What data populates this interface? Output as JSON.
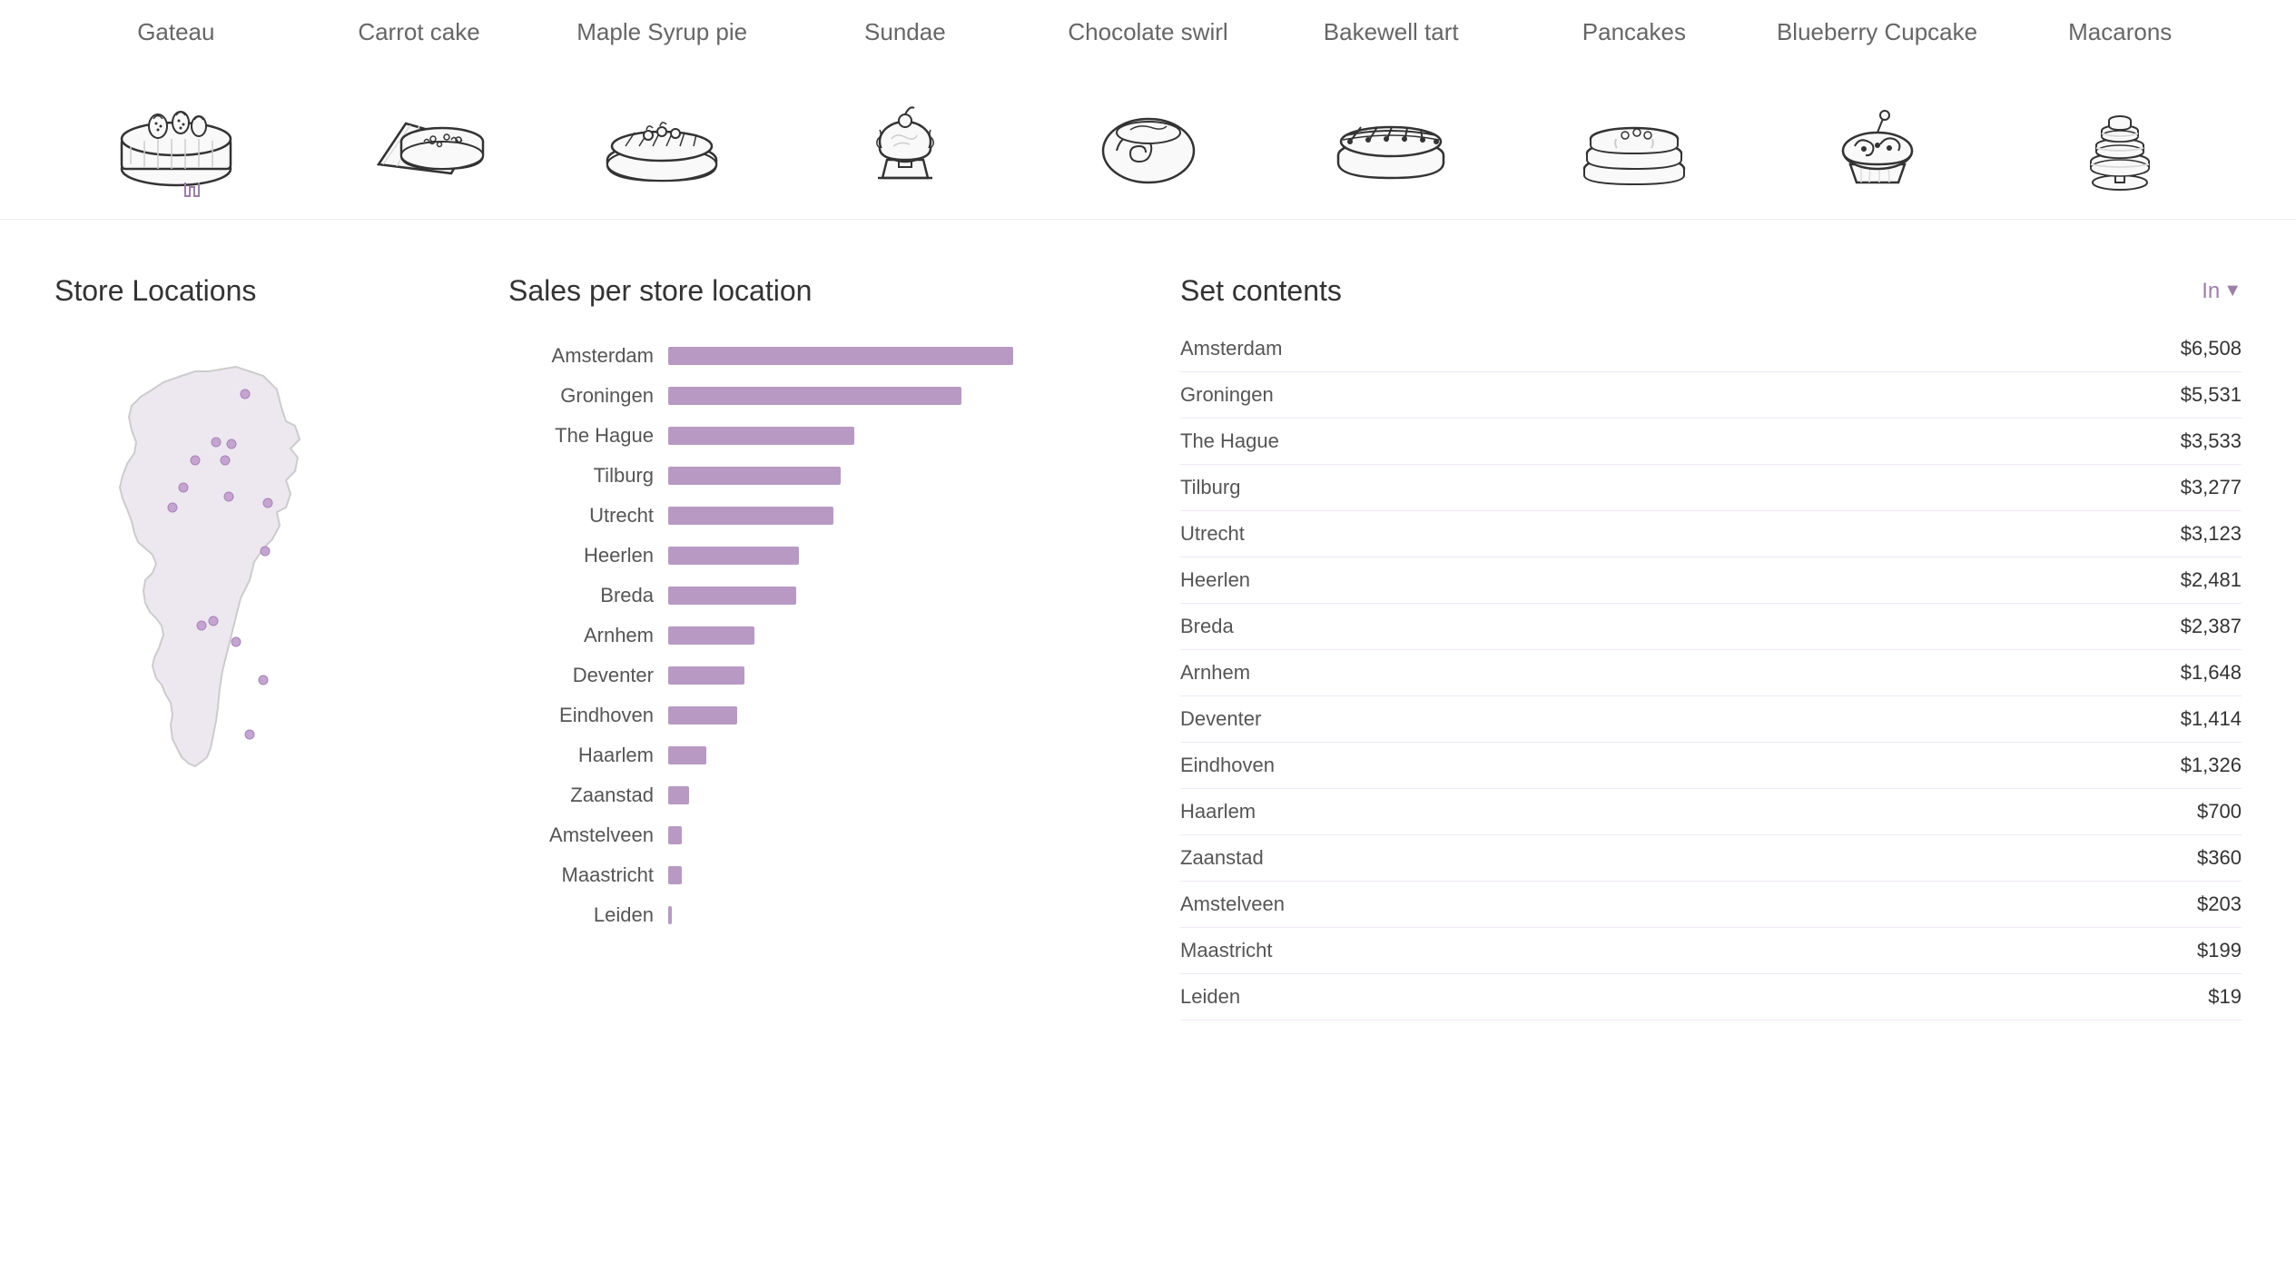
{
  "desserts": [
    {
      "id": "gateau",
      "label": "Gateau",
      "active": false
    },
    {
      "id": "carrot-cake",
      "label": "Carrot cake",
      "active": false
    },
    {
      "id": "maple-syrup-pie",
      "label": "Maple Syrup pie",
      "active": false
    },
    {
      "id": "sundae",
      "label": "Sundae",
      "active": false
    },
    {
      "id": "chocolate-swirl",
      "label": "Chocolate swirl",
      "active": false
    },
    {
      "id": "bakewell-tart",
      "label": "Bakewell tart",
      "active": false
    },
    {
      "id": "pancakes",
      "label": "Pancakes",
      "active": false
    },
    {
      "id": "blueberry-cupcake",
      "label": "Blueberry Cupcake",
      "active": false
    },
    {
      "id": "macarons",
      "label": "Macarons",
      "active": false
    }
  ],
  "store_locations_title": "Store Locations",
  "sales_title": "Sales per store location",
  "set_contents_title": "Set contents",
  "set_header_label": "In",
  "sales_data": [
    {
      "city": "Amsterdam",
      "value": 6508,
      "bar_pct": 100
    },
    {
      "city": "Groningen",
      "value": 5531,
      "bar_pct": 85
    },
    {
      "city": "The Hague",
      "value": 3533,
      "bar_pct": 54
    },
    {
      "city": "Tilburg",
      "value": 3277,
      "bar_pct": 50
    },
    {
      "city": "Utrecht",
      "value": 3123,
      "bar_pct": 48
    },
    {
      "city": "Heerlen",
      "value": 2481,
      "bar_pct": 38
    },
    {
      "city": "Breda",
      "value": 2387,
      "bar_pct": 37
    },
    {
      "city": "Arnhem",
      "value": 1648,
      "bar_pct": 25
    },
    {
      "city": "Deventer",
      "value": 1414,
      "bar_pct": 22
    },
    {
      "city": "Eindhoven",
      "value": 1326,
      "bar_pct": 20
    },
    {
      "city": "Haarlem",
      "value": 700,
      "bar_pct": 11
    },
    {
      "city": "Zaanstad",
      "value": 360,
      "bar_pct": 6
    },
    {
      "city": "Amstelveen",
      "value": 203,
      "bar_pct": 4
    },
    {
      "city": "Maastricht",
      "value": 199,
      "bar_pct": 4
    },
    {
      "city": "Leiden",
      "value": 19,
      "bar_pct": 1
    }
  ],
  "set_data": [
    {
      "city": "Amsterdam",
      "value": "$6,508"
    },
    {
      "city": "Groningen",
      "value": "$5,531"
    },
    {
      "city": "The Hague",
      "value": "$3,533"
    },
    {
      "city": "Tilburg",
      "value": "$3,277"
    },
    {
      "city": "Utrecht",
      "value": "$3,123"
    },
    {
      "city": "Heerlen",
      "value": "$2,481"
    },
    {
      "city": "Breda",
      "value": "$2,387"
    },
    {
      "city": "Arnhem",
      "value": "$1,648"
    },
    {
      "city": "Deventer",
      "value": "$1,414"
    },
    {
      "city": "Eindhoven",
      "value": "$1,326"
    },
    {
      "city": "Haarlem",
      "value": "$700"
    },
    {
      "city": "Zaanstad",
      "value": "$360"
    },
    {
      "city": "Amstelveen",
      "value": "$203"
    },
    {
      "city": "Maastricht",
      "value": "$199"
    },
    {
      "city": "Leiden",
      "value": "$19"
    }
  ],
  "colors": {
    "bar": "#b899c4",
    "active_text": "#9b7fa8",
    "filter_icon": "#9b7fa8"
  }
}
